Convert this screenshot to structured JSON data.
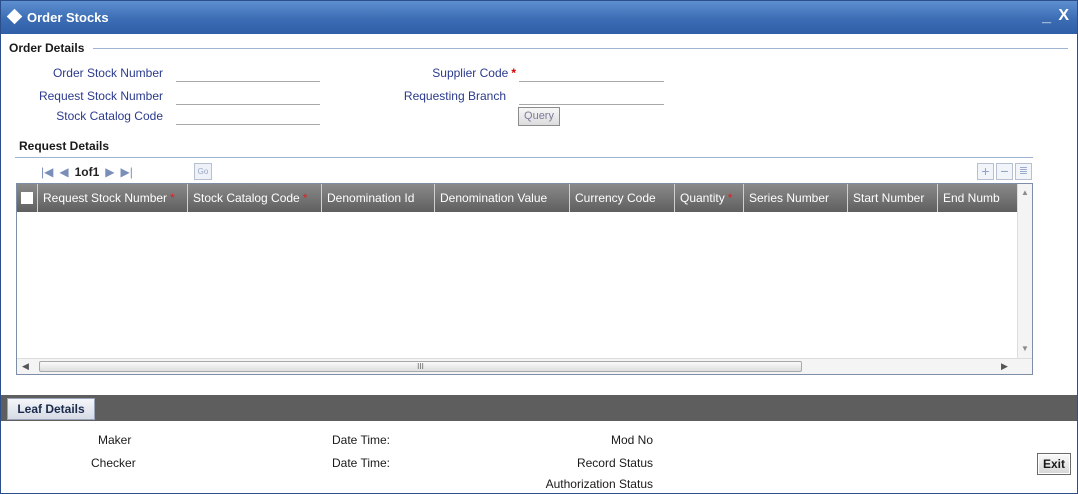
{
  "window": {
    "title": "Order Stocks",
    "minimize": "_",
    "close": "X"
  },
  "order_details": {
    "header": "Order Details",
    "order_stock_number": {
      "label": "Order Stock Number",
      "value": ""
    },
    "request_stock_number": {
      "label": "Request Stock Number",
      "value": ""
    },
    "stock_catalog_code": {
      "label": "Stock Catalog Code",
      "value": ""
    },
    "supplier_code": {
      "label": "Supplier Code",
      "required": "*",
      "value": ""
    },
    "requesting_branch": {
      "label": "Requesting Branch",
      "value": ""
    },
    "query_button": "Query"
  },
  "request_details": {
    "header": "Request Details",
    "pager": {
      "first": "|◀",
      "prev": "◀",
      "page": "1of1",
      "next": "▶",
      "last": "▶|",
      "go": "Go"
    },
    "toolbar": {
      "add": "+",
      "remove": "−",
      "view": "≣"
    },
    "columns": [
      {
        "label": "Request Stock Number",
        "required": "*"
      },
      {
        "label": "Stock Catalog Code",
        "required": "*"
      },
      {
        "label": "Denomination Id",
        "required": ""
      },
      {
        "label": "Denomination Value",
        "required": ""
      },
      {
        "label": "Currency Code",
        "required": ""
      },
      {
        "label": "Quantity",
        "required": "*"
      },
      {
        "label": "Series Number",
        "required": ""
      },
      {
        "label": "Start Number",
        "required": ""
      },
      {
        "label": "End Numb",
        "required": ""
      }
    ],
    "scroll_grip": "III"
  },
  "leaf_details": {
    "tab": "Leaf Details"
  },
  "audit": {
    "maker": "Maker",
    "checker": "Checker",
    "date_time_1": "Date Time:",
    "date_time_2": "Date Time:",
    "mod_no": "Mod No",
    "record_status": "Record Status",
    "authorization_status": "Authorization Status",
    "exit_button": "Exit"
  },
  "colors": {
    "title_bar": "#3c6db4",
    "label": "#2b3a8c",
    "required": "#d40000",
    "grid_header": "#6e6e6e",
    "leaf_bar": "#5e5e5e"
  }
}
